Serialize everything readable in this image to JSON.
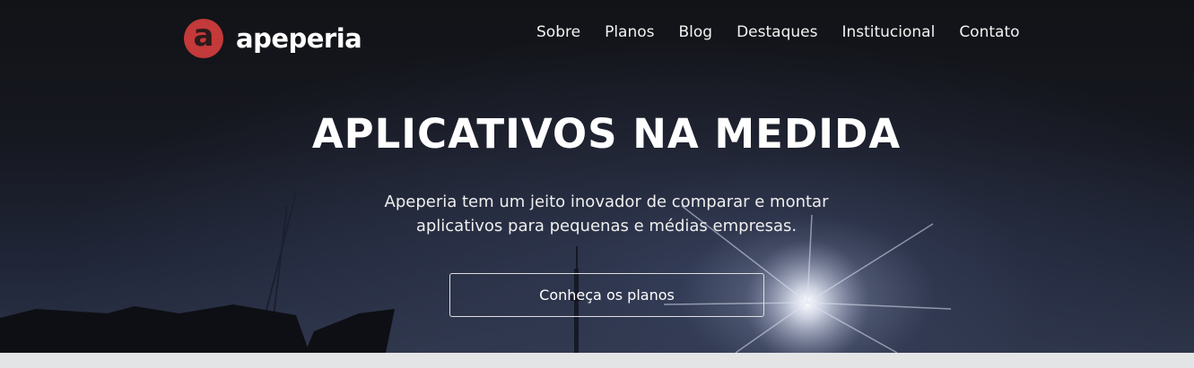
{
  "header": {
    "logo_letter": "a",
    "brand_name": "apeperia",
    "logo_color": "#c4393a",
    "nav": [
      {
        "label": "Sobre"
      },
      {
        "label": "Planos"
      },
      {
        "label": "Blog"
      },
      {
        "label": "Destaques"
      },
      {
        "label": "Institucional"
      },
      {
        "label": "Contato"
      }
    ]
  },
  "hero": {
    "title": "APLICATIVOS NA MEDIDA",
    "subtitle_line1": "Apeperia tem um jeito inovador de comparar e montar",
    "subtitle_line2": "aplicativos para pequenas e médias empresas.",
    "cta_label": "Conheça os planos"
  }
}
